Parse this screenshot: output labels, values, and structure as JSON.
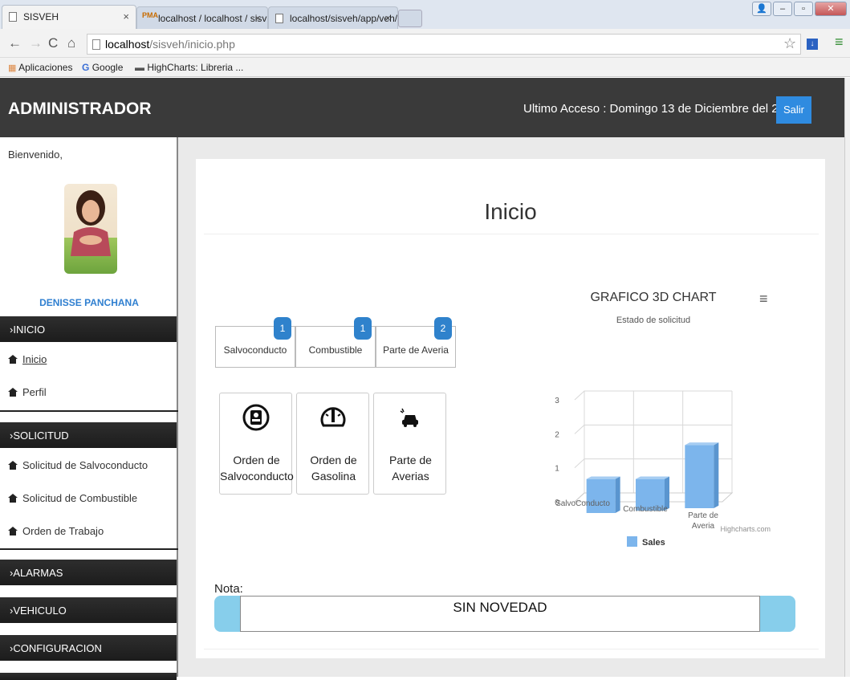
{
  "browser": {
    "tabs": [
      {
        "label": "SISVEH"
      },
      {
        "label": "localhost / localhost / sisv"
      },
      {
        "label": "localhost/sisveh/app/veh/"
      }
    ],
    "url_host": "localhost",
    "url_path": "/sisveh/inicio.php",
    "bookmarks": [
      "Aplicaciones",
      "Google",
      "HighCharts: Libreria ..."
    ]
  },
  "header": {
    "brand": "ADMINISTRADOR",
    "last_access": "Ultimo Acceso : Domingo 13 de Diciembre del 2015",
    "logout": "Salir"
  },
  "sidebar": {
    "welcome": "Bienvenido,",
    "user_name": "DENISSE PANCHANA",
    "sections": [
      {
        "title": "›INICIO",
        "items": [
          "Inicio",
          "Perfil"
        ]
      },
      {
        "title": "›SOLICITUD",
        "items": [
          "Solicitud de Salvoconducto",
          "Solicitud de Combustible",
          "Orden de Trabajo"
        ]
      },
      {
        "title": "›ALARMAS",
        "items": []
      },
      {
        "title": "›VEHICULO",
        "items": []
      },
      {
        "title": "›CONFIGURACION",
        "items": []
      }
    ]
  },
  "main": {
    "title": "Inicio",
    "counters": [
      {
        "label": "Salvoconducto",
        "count": "1"
      },
      {
        "label": "Combustible",
        "count": "1"
      },
      {
        "label": "Parte de Averia",
        "count": "2"
      }
    ],
    "tiles": [
      {
        "line1": "Orden de",
        "line2": "Salvoconducto",
        "icon": "document-badge-icon"
      },
      {
        "line1": "Orden de",
        "line2": "Gasolina",
        "icon": "fuel-gauge-icon"
      },
      {
        "line1": "Parte de",
        "line2": "Averias",
        "icon": "car-crash-icon"
      }
    ],
    "nota_label": "Nota:",
    "nota_value": "SIN NOVEDAD"
  },
  "chart_data": {
    "type": "bar",
    "title": "GRAFICO 3D CHART",
    "subtitle": "Estado de solicitud",
    "categories": [
      "SalvoConducto",
      "Combustible",
      "Parte de Averia"
    ],
    "series": [
      {
        "name": "Sales",
        "values": [
          1,
          1,
          2
        ],
        "color": "#7cb5ec"
      }
    ],
    "ylim": [
      0,
      3
    ],
    "yticks": [
      0,
      1,
      2,
      3
    ],
    "grid": true,
    "legend": "bottom-center",
    "credits": "Highcharts.com"
  },
  "colors": {
    "accent": "#2f8be0",
    "header_bg": "#3a3a3a",
    "badge": "#2f82cc",
    "nota": "#87ceeb"
  }
}
